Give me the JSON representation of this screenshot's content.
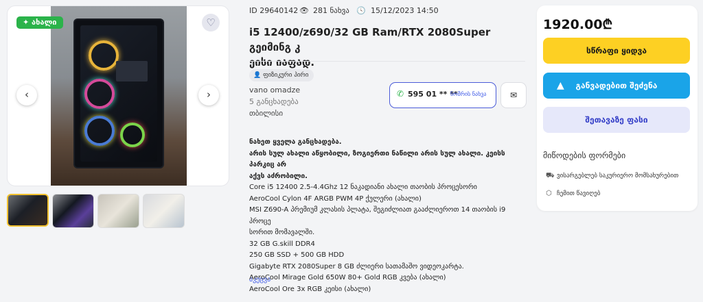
{
  "gallery": {
    "badge": "✦ ახალი",
    "thumb_count": 4
  },
  "meta": {
    "id": "ID 29640142",
    "views": "281 ნახვა",
    "date": "15/12/2023 14:50"
  },
  "title_line1": "i5 12400/z690/32 GB Ram/RTX 2080Super გეიმინგ კ",
  "title_line2": "ეისი იაფად.",
  "seller": {
    "tag": "ფიზიკური პირი",
    "name": "vano omadze",
    "ads": "5 განცხადება",
    "city": "თბილისი"
  },
  "phone": {
    "number": "595 01 ** **",
    "show_label": "ნომრის ნახვა"
  },
  "description": [
    {
      "text": "ნახეთ ყველა განცხადება.",
      "bold": true
    },
    {
      "text": "არის სულ ახალი აწყობილი, ზოგიერთი ნაწილი არის სულ ახალი. კეისს პარკიც არ",
      "bold": true
    },
    {
      "text": "აქვს აძრობილი.",
      "bold": true
    },
    {
      "text": "Core i5 12400 2.5-4.4Ghz 12 ნაკადიანი ახალი თაობის პროცესორი",
      "bold": false
    },
    {
      "text": "AeroCool Cylon 4F ARGB PWM 4P ქულერი (ახალი)",
      "bold": false
    },
    {
      "text": "MSI Z690-A პრემიუმ კლასის პლატა, შეგიძლიათ გააძლიეროთ 14 თაობის i9 პროცე",
      "bold": false
    },
    {
      "text": "სორით მომავალში.",
      "bold": false
    },
    {
      "text": "32 GB G.skill DDR4",
      "bold": false
    },
    {
      "text": "250 GB SSD + 500 GB HDD",
      "bold": false
    },
    {
      "text": "Gigabyte RTX 2080Super 8 GB ძლიერი სათამაშო ვიდეოკარტა.",
      "bold": false
    },
    {
      "text": "AeroCool Mirage Gold 650W 80+ Gold RGB კვება (ახალი)",
      "bold": false
    },
    {
      "text": "AeroCool Ore 3x RGB კეისი (ახალი)",
      "bold": false
    }
  ],
  "more_link": "აკეცვა",
  "sidebar": {
    "price": "1920.00₾",
    "buy_label": "სწრაფი ყიდვა",
    "installment_label": "განვადებით შეძენა",
    "offer_label": "შეთავაზე ფასი",
    "payment_title": "მიწოდების ფორმები",
    "payment_items": [
      {
        "icon": "truck-icon",
        "label": "ვისარგებლებ საკურიერო მომსახურებით"
      },
      {
        "icon": "handshake-icon",
        "label": "ჩემით წავიღებ"
      }
    ]
  },
  "colors": {
    "accent_blue": "#3b57e7",
    "buy_yellow": "#fdd023",
    "installment_blue": "#1aa4e8",
    "badge_green": "#2bb34a"
  }
}
